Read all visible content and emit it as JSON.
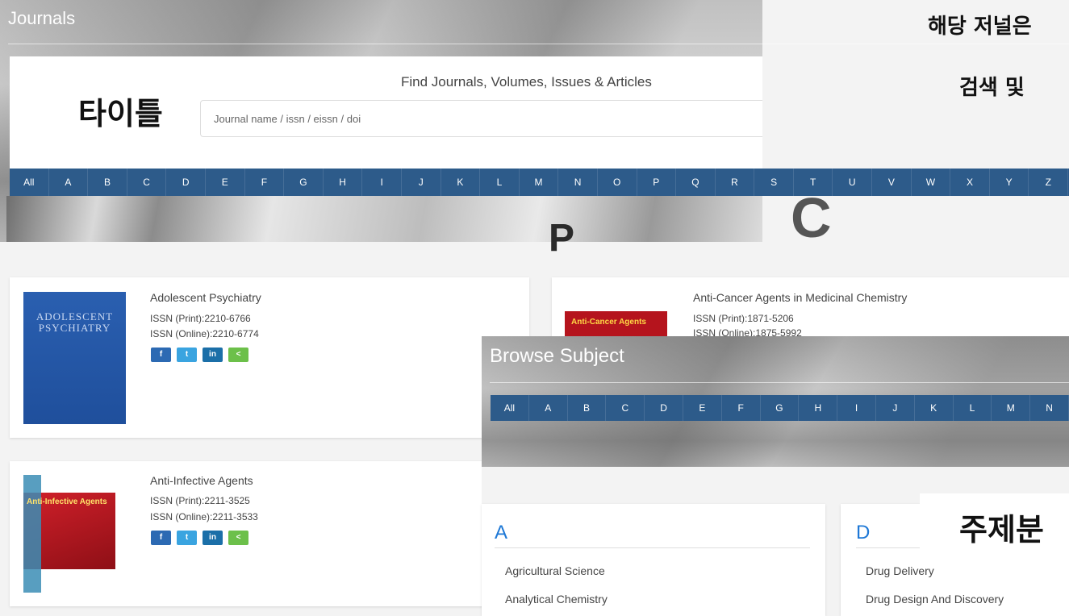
{
  "journals": {
    "hero_title": "Journals",
    "find_text": "Find Journals, Volumes, Issues & Articles",
    "search_placeholder": "Journal name / issn / eissn / doi",
    "hero_letters": [
      "P",
      "C"
    ],
    "alpha": [
      "All",
      "A",
      "B",
      "C",
      "D",
      "E",
      "F",
      "G",
      "H",
      "I",
      "J",
      "K",
      "L",
      "M",
      "N",
      "O",
      "P",
      "Q",
      "R",
      "S",
      "T",
      "U",
      "V",
      "W",
      "X",
      "Y",
      "Z"
    ]
  },
  "annotations": {
    "title_label": "타이틀",
    "top_right_line1": "해당 저널은",
    "top_right_line2": "검색 및",
    "subject_label": "주제분"
  },
  "cards": [
    {
      "title": "Adolescent Psychiatry",
      "issn_print": "ISSN (Print):2210-6766",
      "issn_online": "ISSN (Online):2210-6774",
      "cover_text": "ADOLESCENT PSYCHIATRY"
    },
    {
      "title": "Anti-Infective Agents",
      "issn_print": "ISSN (Print):2211-3525",
      "issn_online": "ISSN (Online):2211-3533",
      "cover_text": "Anti-Infective Agents"
    },
    {
      "title": "Anti-Cancer Agents in Medicinal Chemistry",
      "issn_print": "ISSN (Print):1871-5206",
      "issn_online": "ISSN (Online):1875-5992",
      "cover_text": "Anti-Cancer Agents"
    }
  ],
  "share": {
    "facebook": "f",
    "twitter": "t",
    "linkedin": "in",
    "share": "<"
  },
  "browse": {
    "title": "Browse Subject",
    "alpha": [
      "All",
      "A",
      "B",
      "C",
      "D",
      "E",
      "F",
      "G",
      "H",
      "I",
      "J",
      "K",
      "L",
      "M",
      "N"
    ],
    "groups": [
      {
        "letter": "A",
        "items": [
          "Agricultural Science",
          "Analytical Chemistry"
        ]
      },
      {
        "letter": "D",
        "items": [
          "Drug Delivery",
          "Drug Design And Discovery"
        ]
      }
    ]
  }
}
